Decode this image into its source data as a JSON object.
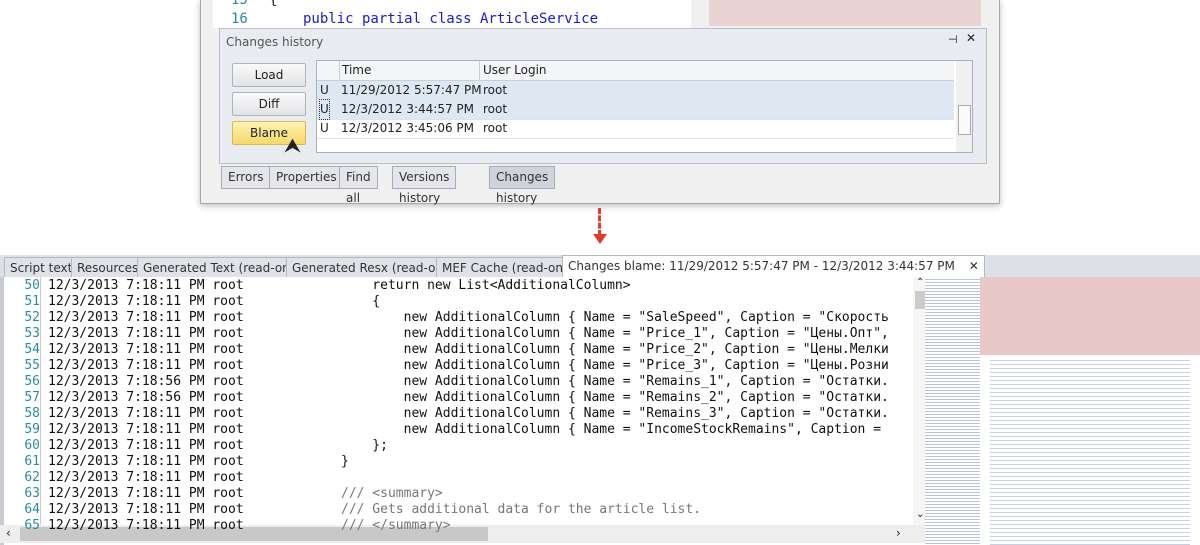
{
  "top_editor": {
    "lines": [
      {
        "num": "15",
        "code": "{"
      },
      {
        "num": "16",
        "code": "public partial class ArticleService"
      }
    ]
  },
  "changes_history": {
    "title": "Changes history",
    "buttons": {
      "load": "Load",
      "diff": "Diff",
      "blame": "Blame"
    },
    "columns": [
      "Time",
      "User Login"
    ],
    "rows": [
      {
        "type": "U",
        "time": "11/29/2012 5:57:47 PM",
        "user": "root",
        "selected": true
      },
      {
        "type": "U",
        "time": "12/3/2012 3:44:57 PM",
        "user": "root",
        "selected": true
      },
      {
        "type": "U",
        "time": "12/3/2012 3:45:06 PM",
        "user": "root",
        "selected": false
      }
    ],
    "pin_icon": "pin-icon",
    "close_icon": "close-icon"
  },
  "bottom_tabs_top": [
    "Errors",
    "Properties",
    "Find all",
    "Versions history",
    "Changes history"
  ],
  "doc_tabs": [
    "Script text",
    "Resources",
    "Generated Text (read-only)",
    "Generated Resx (read-only)",
    "MEF Cache (read-only)",
    "Changes blame: 11/29/2012 5:57:47 PM - 12/3/2012 3:44:57 PM"
  ],
  "blame_lines": [
    {
      "num": "50",
      "blame": "12/3/2013 7:18:11 PM root",
      "code": "    return new List<AdditionalColumn>"
    },
    {
      "num": "51",
      "blame": "12/3/2013 7:18:11 PM root",
      "code": "    {"
    },
    {
      "num": "52",
      "blame": "12/3/2013 7:18:11 PM root",
      "code": "        new AdditionalColumn { Name = \"SaleSpeed\", Caption = \"Скорость"
    },
    {
      "num": "53",
      "blame": "12/3/2013 7:18:11 PM root",
      "code": "        new AdditionalColumn { Name = \"Price_1\", Caption = \"Цены.Опт\","
    },
    {
      "num": "54",
      "blame": "12/3/2013 7:18:11 PM root",
      "code": "        new AdditionalColumn { Name = \"Price_2\", Caption = \"Цены.Мелки"
    },
    {
      "num": "55",
      "blame": "12/3/2013 7:18:11 PM root",
      "code": "        new AdditionalColumn { Name = \"Price_3\", Caption = \"Цены.Розни"
    },
    {
      "num": "56",
      "blame": "12/3/2013 7:18:56 PM root",
      "code": "        new AdditionalColumn { Name = \"Remains_1\", Caption = \"Остатки."
    },
    {
      "num": "57",
      "blame": "12/3/2013 7:18:56 PM root",
      "code": "        new AdditionalColumn { Name = \"Remains_2\", Caption = \"Остатки."
    },
    {
      "num": "58",
      "blame": "12/3/2013 7:18:11 PM root",
      "code": "        new AdditionalColumn { Name = \"Remains_3\", Caption = \"Остатки."
    },
    {
      "num": "59",
      "blame": "12/3/2013 7:18:11 PM root",
      "code": "        new AdditionalColumn { Name = \"IncomeStockRemains\", Caption ="
    },
    {
      "num": "60",
      "blame": "12/3/2013 7:18:11 PM root",
      "code": "    };"
    },
    {
      "num": "61",
      "blame": "12/3/2013 7:18:11 PM root",
      "code": "}"
    },
    {
      "num": "62",
      "blame": "12/3/2013 7:18:11 PM root",
      "code": ""
    },
    {
      "num": "63",
      "blame": "12/3/2013 7:18:11 PM root",
      "code": "/// <summary>",
      "comment": true
    },
    {
      "num": "64",
      "blame": "12/3/2013 7:18:11 PM root",
      "code": "/// Gets additional data for the article list.",
      "comment": true
    },
    {
      "num": "65",
      "blame": "12/3/2013 7:18:11 PM root",
      "code": "/// </summary>",
      "comment": true
    }
  ],
  "colors": {
    "accent_arrow": "#e53a2a",
    "selected_row": "#dde8f3",
    "blame_button": "#f6d86a",
    "minimap_highlight": "#e8c8c8"
  }
}
